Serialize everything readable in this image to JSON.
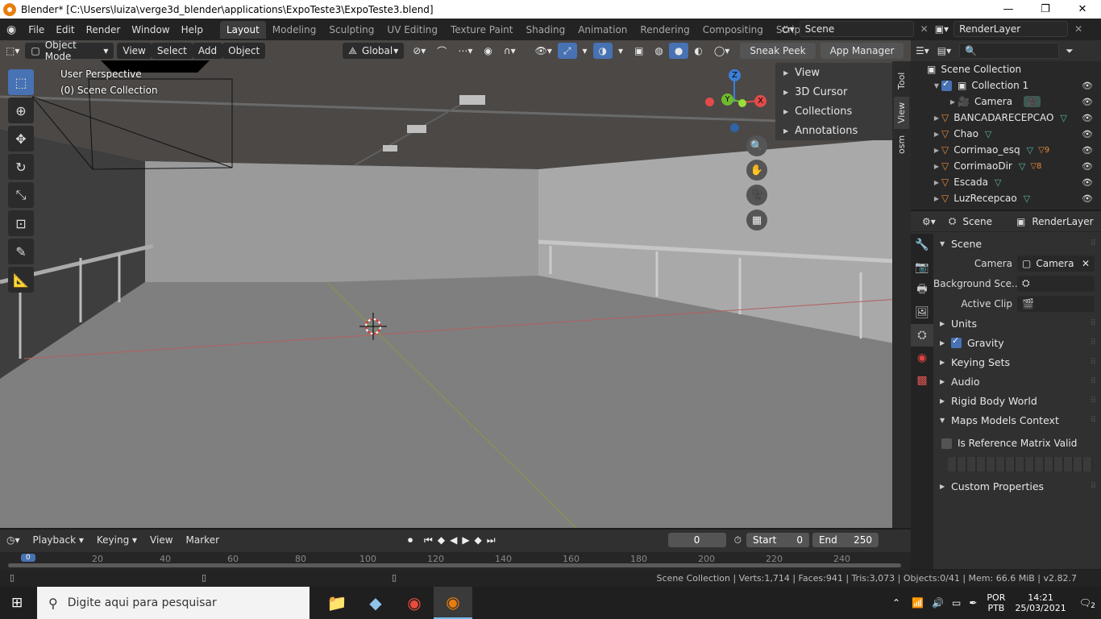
{
  "window": {
    "title": "Blender* [C:\\Users\\luiza\\verge3d_blender\\applications\\ExpoTeste3\\ExpoTeste3.blend]"
  },
  "menu": [
    "File",
    "Edit",
    "Render",
    "Window",
    "Help"
  ],
  "workspaces": [
    "Layout",
    "Modeling",
    "Sculpting",
    "UV Editing",
    "Texture Paint",
    "Shading",
    "Animation",
    "Rendering",
    "Compositing",
    "Scripting"
  ],
  "scene": "Scene",
  "render_layer": "RenderLayer",
  "viewport": {
    "mode": "Object Mode",
    "menus": [
      "View",
      "Select",
      "Add",
      "Object"
    ],
    "orientation": "Global",
    "buttons": [
      "Sneak Peek",
      "App Manager"
    ],
    "perspective_label": "User Perspective",
    "collection_label": "(0) Scene Collection",
    "npanel": [
      "View",
      "3D Cursor",
      "Collections",
      "Annotations"
    ],
    "side_tabs": [
      "Tool",
      "View",
      "osm"
    ],
    "gizmo": {
      "z": "Z",
      "y": "Y",
      "x": "X"
    }
  },
  "outliner": {
    "root": "Scene Collection",
    "items": [
      {
        "name": "Collection 1",
        "level": 1
      },
      {
        "name": "Camera",
        "level": 2
      },
      {
        "name": "BANCADARECEPCAO",
        "level": 1
      },
      {
        "name": "Chao",
        "level": 1
      },
      {
        "name": "Corrimao_esq",
        "level": 1,
        "badge": "9"
      },
      {
        "name": "CorrimaoDir",
        "level": 1,
        "badge": "8"
      },
      {
        "name": "Escada",
        "level": 1
      },
      {
        "name": "LuzRecepcao",
        "level": 1
      }
    ]
  },
  "properties": {
    "scene_tab": "Scene",
    "layer_tab": "RenderLayer",
    "section": "Scene",
    "camera_label": "Camera",
    "camera_value": "Camera",
    "background_label": "Background Sce..",
    "clip_label": "Active Clip",
    "panels": [
      "Units",
      "Gravity",
      "Keying Sets",
      "Audio",
      "Rigid Body World",
      "Maps Models Context"
    ],
    "ref_matrix": "Is Reference Matrix Valid",
    "custom": "Custom Properties"
  },
  "timeline": {
    "menus": [
      "Playback",
      "Keying",
      "View",
      "Marker"
    ],
    "current": "0",
    "start_label": "Start",
    "start": "0",
    "end_label": "End",
    "end": "250",
    "ticks": [
      "0",
      "20",
      "40",
      "60",
      "80",
      "100",
      "120",
      "140",
      "160",
      "180",
      "200",
      "220",
      "240"
    ]
  },
  "status": "Scene Collection | Verts:1,714 | Faces:941 | Tris:3,073 | Objects:0/41 | Mem: 66.6 MiB | v2.82.7",
  "taskbar": {
    "search_placeholder": "Digite aqui para pesquisar",
    "lang1": "POR",
    "lang2": "PTB",
    "time": "14:21",
    "date": "25/03/2021",
    "notif": "2"
  },
  "colors": {
    "accent": "#4772b3",
    "blender_orange": "#e87d0d",
    "mesh_icon": "#e5893a"
  }
}
